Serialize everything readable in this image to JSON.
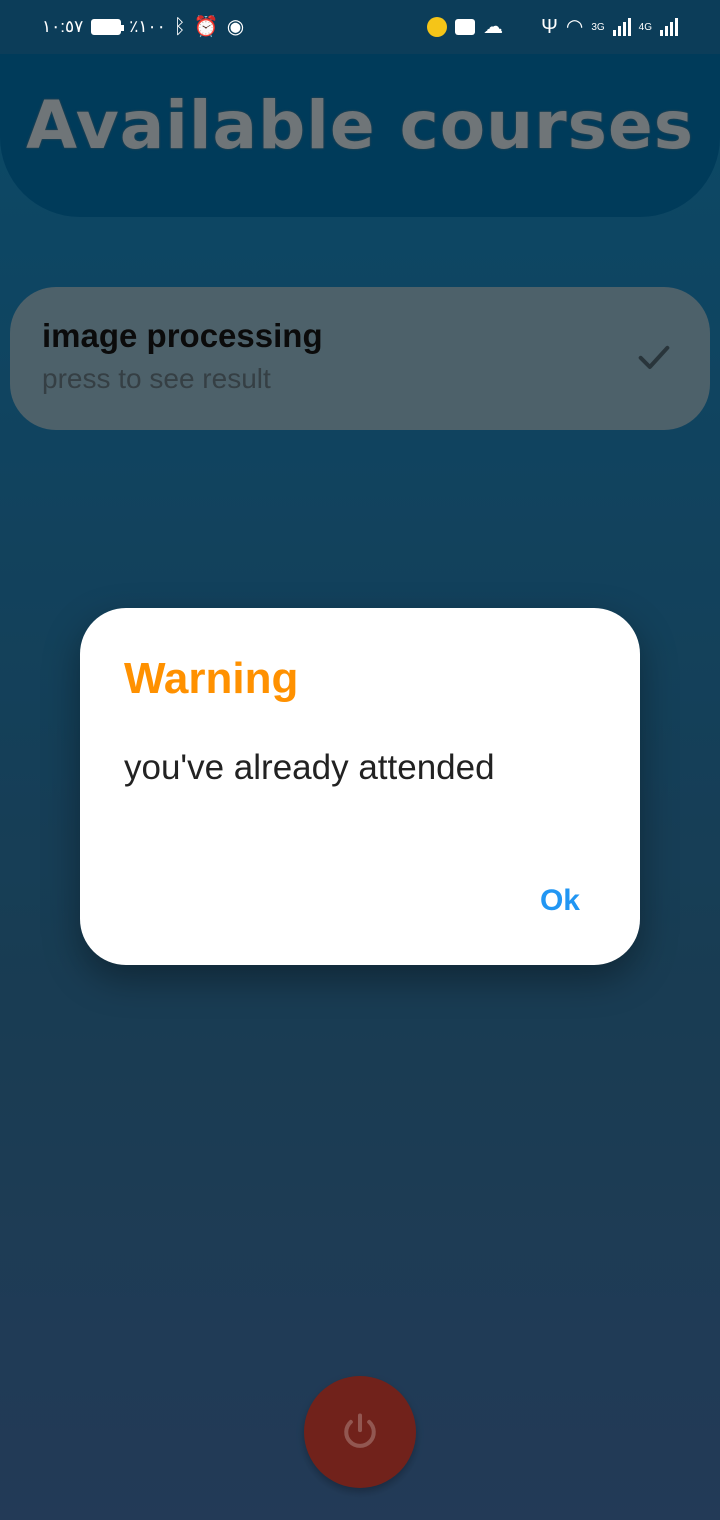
{
  "status_bar": {
    "time": "١٠:٥٧",
    "battery": "٪١٠٠",
    "network_3g": "3G",
    "network_4g": "4G"
  },
  "header": {
    "title": "Available courses"
  },
  "courses": [
    {
      "title": "image processing",
      "subtitle": "press to see result"
    }
  ],
  "dialog": {
    "title": "Warning",
    "message": "you've already attended",
    "ok_label": "Ok"
  },
  "colors": {
    "header_bg": "#005582",
    "dialog_title": "#ff9100",
    "dialog_ok": "#2196f3",
    "power_button": "#a33227"
  },
  "icons": {
    "course_status": "check-icon",
    "fab": "power-icon"
  }
}
